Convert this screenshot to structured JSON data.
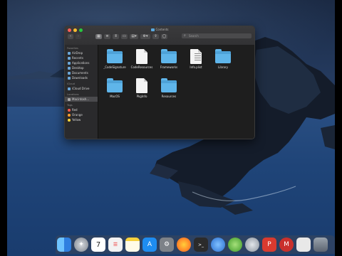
{
  "window": {
    "title": "Contents",
    "search_placeholder": "Search"
  },
  "sidebar": {
    "favorites_label": "Favorites",
    "favorites": [
      "AirDrop",
      "Recents",
      "Applications",
      "Desktop",
      "Documents",
      "Downloads"
    ],
    "icloud_label": "iCloud",
    "icloud": [
      "iCloud Drive"
    ],
    "locations_label": "Locations",
    "locations": [
      "Macintosh..."
    ],
    "tags_label": "Tags",
    "tags": [
      {
        "name": "Red",
        "color": "#ff5b4e"
      },
      {
        "name": "Orange",
        "color": "#ff9f2e"
      },
      {
        "name": "Yellow",
        "color": "#ffd93a"
      }
    ]
  },
  "files": [
    {
      "name": "_CodeSignature",
      "kind": "folder"
    },
    {
      "name": "CodeResources",
      "kind": "document"
    },
    {
      "name": "Frameworks",
      "kind": "folder"
    },
    {
      "name": "Info.plist",
      "kind": "document"
    },
    {
      "name": "Library",
      "kind": "folder"
    },
    {
      "name": "MacOS",
      "kind": "folder"
    },
    {
      "name": "PkgInfo",
      "kind": "document"
    },
    {
      "name": "Resources",
      "kind": "folder"
    }
  ],
  "dock": [
    {
      "icon": "finder-icon",
      "color": "#3b8ee8"
    },
    {
      "icon": "launchpad-icon",
      "color": "#8a8f99"
    },
    {
      "icon": "calendar-icon",
      "color": "#ffffff",
      "label": "7"
    },
    {
      "icon": "reminders-icon",
      "color": "#f2f2f2"
    },
    {
      "icon": "notes-icon",
      "color": "#f7d23e"
    },
    {
      "icon": "app-store-icon",
      "color": "#1e8cf0"
    },
    {
      "icon": "system-preferences-icon",
      "color": "#7d8288"
    },
    {
      "icon": "firefox-icon",
      "color": "#ff7a1e"
    },
    {
      "icon": "terminal-icon",
      "color": "#2b2b2b"
    },
    {
      "icon": "safari-icon",
      "color": "#2a6fd0"
    },
    {
      "icon": "tweaks-icon",
      "color": "#5cbf44"
    },
    {
      "icon": "cleaner-icon",
      "color": "#9aa3ad"
    },
    {
      "icon": "pdf-icon",
      "color": "#d93a2f"
    },
    {
      "icon": "office-icon",
      "color": "#c9302c"
    },
    {
      "icon": "documents-icon",
      "color": "#e8e8e8"
    },
    {
      "icon": "trash-icon",
      "color": "#5c6470"
    }
  ],
  "colors": {
    "close": "#ff5f57",
    "minimize": "#ffbd2e",
    "zoom": "#28c840"
  }
}
